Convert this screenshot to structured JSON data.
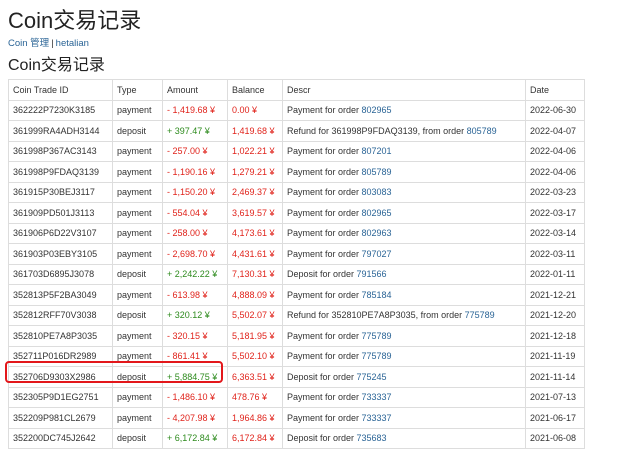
{
  "page_title": "Coin交易记录",
  "breadcrumb": {
    "root": "Coin 管理",
    "sep": "|",
    "user": "hetalian"
  },
  "section_title": "Coin交易记录",
  "columns": [
    "Coin Trade ID",
    "Type",
    "Amount",
    "Balance",
    "Descr",
    "Date"
  ],
  "rows": [
    {
      "id": "362222P7230K3185",
      "type": "payment",
      "amount": "- 1,419.68 ¥",
      "sign": "neg",
      "balance": "0.00 ¥",
      "descr": "Payment for order ",
      "order": "802965",
      "date": "2022-06-30"
    },
    {
      "id": "361999RA4ADH3144",
      "type": "deposit",
      "amount": "+ 397.47 ¥",
      "sign": "pos",
      "balance": "1,419.68 ¥",
      "descr": "Refund for 361998P9FDAQ3139, from order ",
      "order": "805789",
      "date": "2022-04-07"
    },
    {
      "id": "361998P367AC3143",
      "type": "payment",
      "amount": "- 257.00 ¥",
      "sign": "neg",
      "balance": "1,022.21 ¥",
      "descr": "Payment for order ",
      "order": "807201",
      "date": "2022-04-06"
    },
    {
      "id": "361998P9FDAQ3139",
      "type": "payment",
      "amount": "- 1,190.16 ¥",
      "sign": "neg",
      "balance": "1,279.21 ¥",
      "descr": "Payment for order ",
      "order": "805789",
      "date": "2022-04-06"
    },
    {
      "id": "361915P30BEJ3117",
      "type": "payment",
      "amount": "- 1,150.20 ¥",
      "sign": "neg",
      "balance": "2,469.37 ¥",
      "descr": "Payment for order ",
      "order": "803083",
      "date": "2022-03-23"
    },
    {
      "id": "361909PD501J3113",
      "type": "payment",
      "amount": "- 554.04 ¥",
      "sign": "neg",
      "balance": "3,619.57 ¥",
      "descr": "Payment for order ",
      "order": "802965",
      "date": "2022-03-17"
    },
    {
      "id": "361906P6D22V3107",
      "type": "payment",
      "amount": "- 258.00 ¥",
      "sign": "neg",
      "balance": "4,173.61 ¥",
      "descr": "Payment for order ",
      "order": "802963",
      "date": "2022-03-14"
    },
    {
      "id": "361903P03EBY3105",
      "type": "payment",
      "amount": "- 2,698.70 ¥",
      "sign": "neg",
      "balance": "4,431.61 ¥",
      "descr": "Payment for order ",
      "order": "797027",
      "date": "2022-03-11"
    },
    {
      "id": "361703D6895J3078",
      "type": "deposit",
      "amount": "+ 2,242.22 ¥",
      "sign": "pos",
      "balance": "7,130.31 ¥",
      "descr": "Deposit for order ",
      "order": "791566",
      "date": "2022-01-11"
    },
    {
      "id": "352813P5F2BA3049",
      "type": "payment",
      "amount": "- 613.98 ¥",
      "sign": "neg",
      "balance": "4,888.09 ¥",
      "descr": "Payment for order ",
      "order": "785184",
      "date": "2021-12-21"
    },
    {
      "id": "352812RFF70V3038",
      "type": "deposit",
      "amount": "+ 320.12 ¥",
      "sign": "pos",
      "balance": "5,502.07 ¥",
      "descr": "Refund for 352810PE7A8P3035, from order ",
      "order": "775789",
      "date": "2021-12-20"
    },
    {
      "id": "352810PE7A8P3035",
      "type": "payment",
      "amount": "- 320.15 ¥",
      "sign": "neg",
      "balance": "5,181.95 ¥",
      "descr": "Payment for order ",
      "order": "775789",
      "date": "2021-12-18"
    },
    {
      "id": "352711P016DR2989",
      "type": "payment",
      "amount": "- 861.41 ¥",
      "sign": "neg",
      "balance": "5,502.10 ¥",
      "descr": "Payment for order ",
      "order": "775789",
      "date": "2021-11-19"
    },
    {
      "id": "352706D9303X2986",
      "type": "deposit",
      "amount": "+ 5,884.75 ¥",
      "sign": "pos",
      "balance": "6,363.51 ¥",
      "descr": "Deposit for order ",
      "order": "775245",
      "date": "2021-11-14"
    },
    {
      "id": "352305P9D1EG2751",
      "type": "payment",
      "amount": "- 1,486.10 ¥",
      "sign": "neg",
      "balance": "478.76 ¥",
      "descr": "Payment for order ",
      "order": "733337",
      "date": "2021-07-13"
    },
    {
      "id": "352209P981CL2679",
      "type": "payment",
      "amount": "- 4,207.98 ¥",
      "sign": "neg",
      "balance": "1,964.86 ¥",
      "descr": "Payment for order ",
      "order": "733337",
      "date": "2021-06-17"
    },
    {
      "id": "352200DC745J2642",
      "type": "deposit",
      "amount": "+ 6,172.84 ¥",
      "sign": "pos",
      "balance": "6,172.84 ¥",
      "descr": "Deposit for order ",
      "order": "735683",
      "date": "2021-06-08"
    }
  ],
  "colors": {
    "negative": "#e0231b",
    "positive": "#2e8b1e",
    "link": "#2a6496",
    "highlight": "#e3171b"
  }
}
